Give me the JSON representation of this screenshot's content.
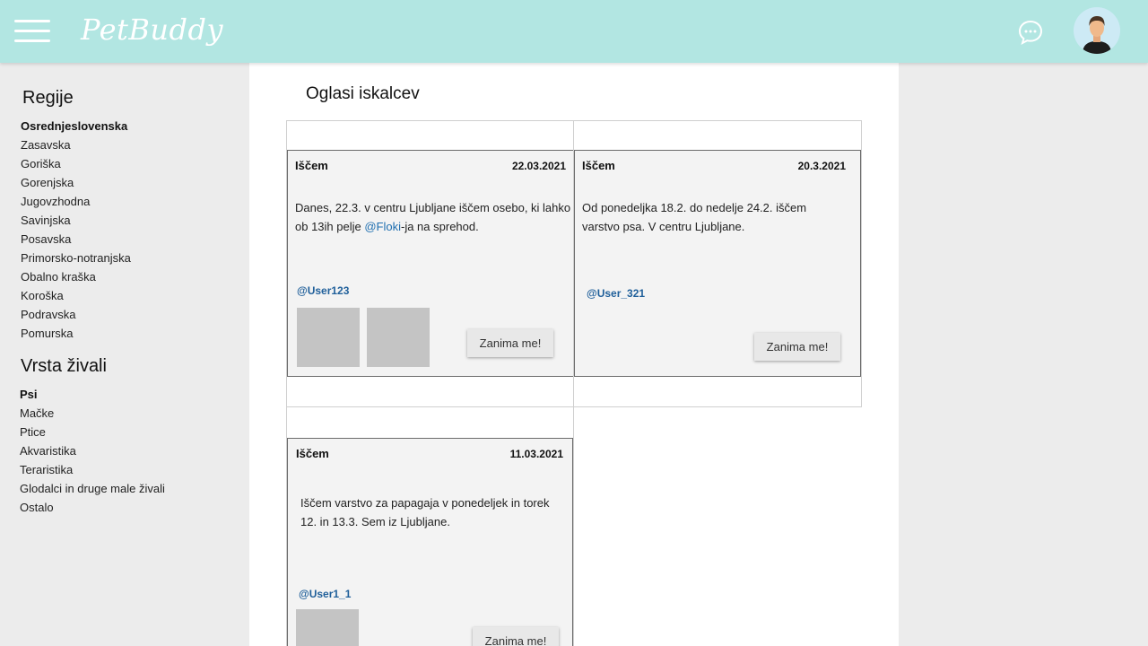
{
  "header": {
    "logo": "PetBuddy"
  },
  "sidebar": {
    "regions_heading": "Regije",
    "regions": [
      {
        "label": "Osrednjeslovenska",
        "active": true
      },
      {
        "label": "Zasavska"
      },
      {
        "label": "Goriška"
      },
      {
        "label": "Gorenjska"
      },
      {
        "label": "Jugovzhodna"
      },
      {
        "label": "Savinjska"
      },
      {
        "label": "Posavska"
      },
      {
        "label": "Primorsko-notranjska"
      },
      {
        "label": "Obalno kraška"
      },
      {
        "label": "Koroška"
      },
      {
        "label": "Podravska"
      },
      {
        "label": "Pomurska"
      }
    ],
    "animals_heading": "Vrsta živali",
    "animals": [
      {
        "label": "Psi",
        "active": true
      },
      {
        "label": "Mačke"
      },
      {
        "label": "Ptice"
      },
      {
        "label": "Akvaristika"
      },
      {
        "label": "Teraristika"
      },
      {
        "label": "Glodalci in druge male živali"
      },
      {
        "label": "Ostalo"
      }
    ]
  },
  "main": {
    "title": "Oglasi iskalcev",
    "ads": [
      {
        "label": "Iščem",
        "date": "22.03.2021",
        "text_before": "Danes, 22.3. v centru Ljubljane iščem osebo, ki lahko ob 13ih pelje ",
        "mention": "@Floki",
        "text_after": "-ja na sprehod.",
        "user": "@User123",
        "button": "Zanima me!"
      },
      {
        "label": "Iščem",
        "date": "20.3.2021",
        "text_before": "Od ponedeljka 18.2. do nedelje 24.2. iščem varstvo psa. V centru Ljubljane.",
        "mention": "",
        "text_after": "",
        "user": "@User_321",
        "button": "Zanima me!"
      },
      {
        "label": "Iščem",
        "date": "11.03.2021",
        "text_before": "Iščem varstvo za papagaja v ponedeljek in torek 12. in 13.3. Sem iz Ljubljane.",
        "mention": "",
        "text_after": "",
        "user": "@User1_1",
        "button": "Zanima me!"
      }
    ]
  },
  "colors": {
    "header_bg": "#b2e6e2",
    "link": "#1f6fb0",
    "photo_placeholder": "#c4c4c4"
  }
}
